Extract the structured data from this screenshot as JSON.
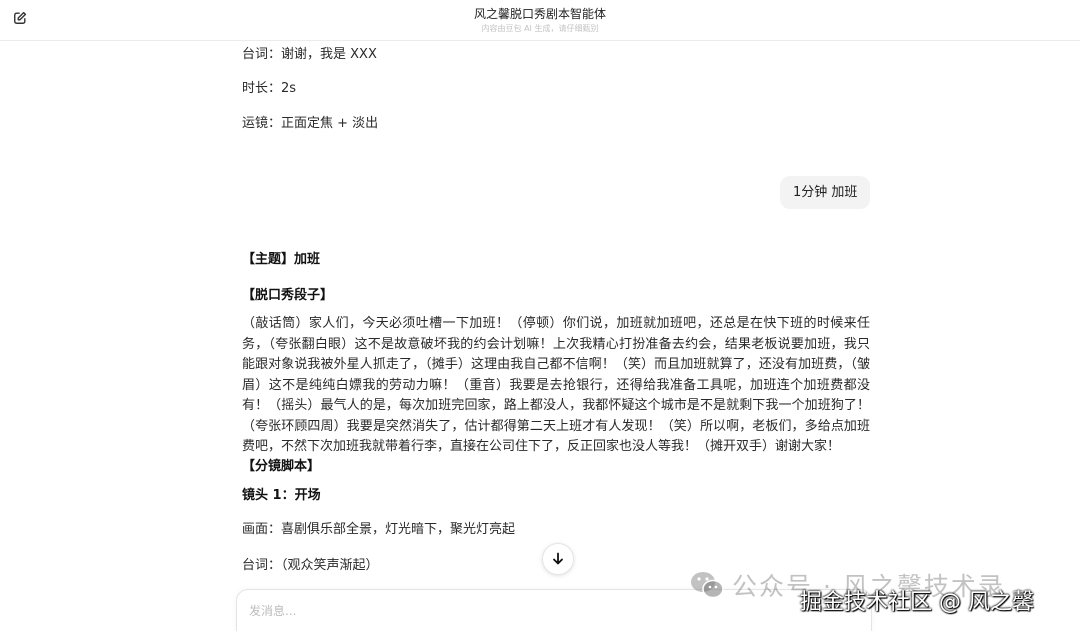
{
  "header": {
    "title": "风之馨脱口秀剧本智能体",
    "subtitle": "内容由豆包 AI 生成，请仔细甄别"
  },
  "conversation": {
    "prev_lines": [
      "台词：谢谢，我是 XXX",
      "时长：2s",
      "运镜：正面定焦 + 淡出"
    ],
    "user_message": "1分钟 加班",
    "reply": {
      "topic": "【主题】加班",
      "joke_heading": "【脱口秀段子】",
      "joke_body": "（敲话筒）家人们，今天必须吐槽一下加班！（停顿）你们说，加班就加班吧，还总是在快下班的时候来任务，（夸张翻白眼）这不是故意破坏我的约会计划嘛！上次我精心打扮准备去约会，结果老板说要加班，我只能跟对象说我被外星人抓走了，（摊手）这理由我自己都不信啊！（笑）而且加班就算了，还没有加班费，（皱眉）这不是纯纯白嫖我的劳动力嘛！（重音）我要是去抢银行，还得给我准备工具呢，加班连个加班费都没有！（摇头）最气人的是，每次加班完回家，路上都没人，我都怀疑这个城市是不是就剩下我一个加班狗了！（夸张环顾四周）我要是突然消失了，估计都得第二天上班才有人发现！（笑）所以啊，老板们，多给点加班费吧，不然下次加班我就带着行李，直接在公司住下了，反正回家也没人等我！（摊开双手）谢谢大家！",
      "storyboard_heading": "【分镜脚本】",
      "shot1_heading": "镜头 1：开场",
      "shot1_scene": "画面：喜剧俱乐部全景，灯光暗下，聚光灯亮起",
      "shot1_line": "台词：（观众笑声渐起）"
    }
  },
  "input": {
    "placeholder": "发消息..."
  },
  "watermark": {
    "line1": "公众号 · 风之馨技术录",
    "line2": "掘金技术社区 @ 风之馨"
  },
  "icons": {
    "new_chat": "edit-square-icon",
    "scroll_down": "arrow-down-icon",
    "wechat": "wechat-icon"
  }
}
